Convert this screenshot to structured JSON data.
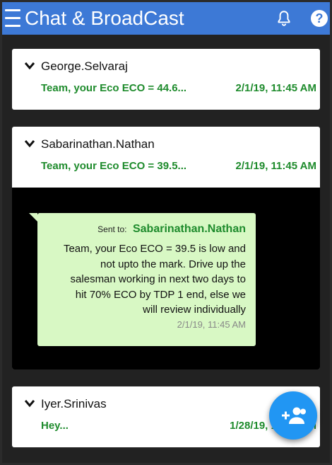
{
  "app": {
    "title": "Chat & BroadCast"
  },
  "header": {
    "icons": [
      "menu-icon",
      "bell-icon",
      "help-icon"
    ],
    "help_glyph": "?"
  },
  "colors": {
    "appbar": "#3d79d6",
    "message_green": "#1e8b2c",
    "bubble": "#d8f8c4",
    "fab": "#2196f3"
  },
  "conversations": [
    {
      "sender": "George.Selvaraj",
      "preview": "Team, your Eco ECO = 44.6...",
      "time": "2/1/19, 11:45 AM",
      "expanded": false
    },
    {
      "sender": "Sabarinathan.Nathan",
      "preview": "Team, your Eco ECO = 39.5...",
      "time": "2/1/19, 11:45 AM",
      "expanded": true,
      "message": {
        "sent_to_label": "Sent to:",
        "recipient": "Sabarinathan.Nathan",
        "lines": [
          "Team, your Eco ECO = 39.5 is low and",
          "not upto the mark. Drive up the",
          "salesman working in next two days to",
          "hit 70% ECO by TDP 1 end, else we",
          "will review individually"
        ],
        "time": "2/1/19, 11:45 AM"
      }
    },
    {
      "sender": "Iyer.Srinivas",
      "preview": "Hey...",
      "time": "1/28/19, 11:45 AM",
      "expanded": false
    }
  ],
  "fab": {
    "icon": "add-group-icon"
  }
}
